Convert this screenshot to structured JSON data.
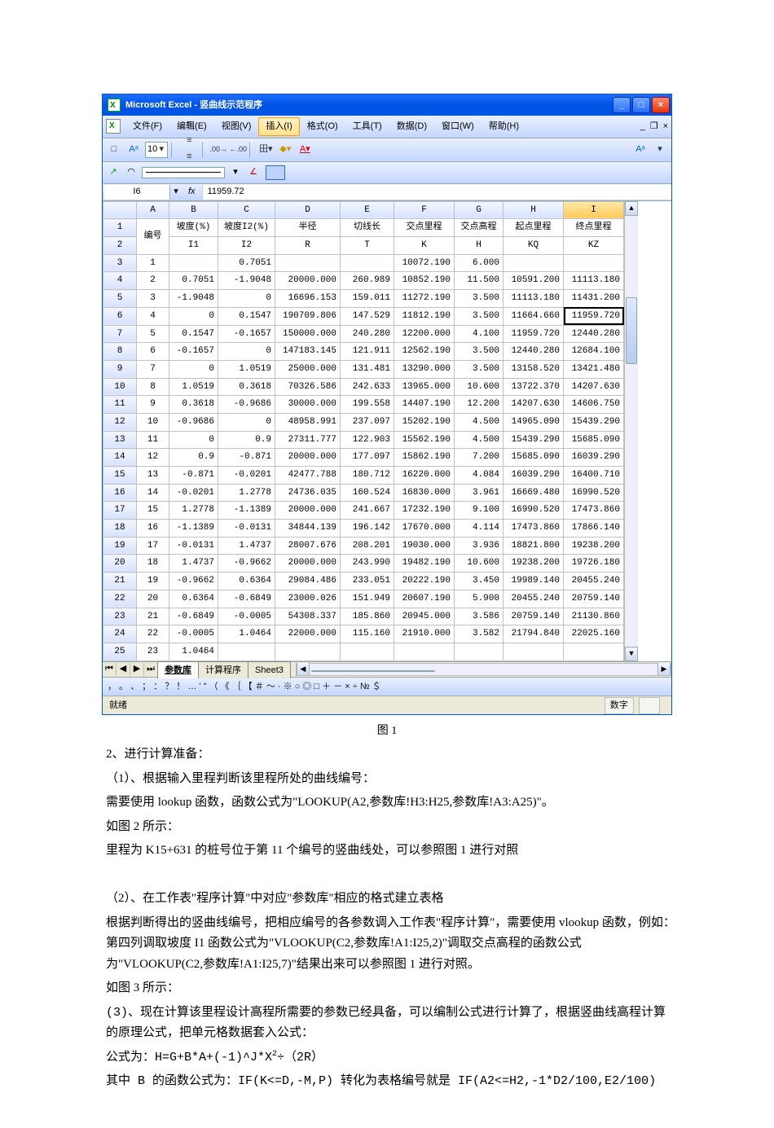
{
  "window": {
    "title": "Microsoft Excel - 竖曲线示范程序"
  },
  "menu": {
    "file": "文件(F)",
    "edit": "编辑(E)",
    "view": "视图(V)",
    "insert": "插入(I)",
    "format": "格式(O)",
    "tools": "工具(T)",
    "data": "数据(D)",
    "window": "窗口(W)",
    "help": "帮助(H)"
  },
  "toolbar": {
    "fontsize": "10"
  },
  "namebox": "I6",
  "formula": "11959.72",
  "columns": [
    "A",
    "B",
    "C",
    "D",
    "E",
    "F",
    "G",
    "H",
    "I"
  ],
  "header1": [
    "编号",
    "坡度(%)",
    "坡度I2(%)",
    "半径",
    "切线长",
    "交点里程",
    "交点高程",
    "起点里程",
    "终点里程"
  ],
  "header2": [
    "",
    "I1",
    "I2",
    "R",
    "T",
    "K",
    "H",
    "KQ",
    "KZ"
  ],
  "rows": [
    {
      "n": "1",
      "I1": "",
      "I2": "0.7051",
      "R": "",
      "T": "",
      "K": "10072.190",
      "H": "6.000",
      "KQ": "",
      "KZ": ""
    },
    {
      "n": "2",
      "I1": "0.7051",
      "I2": "-1.9048",
      "R": "20000.000",
      "T": "260.989",
      "K": "10852.190",
      "H": "11.500",
      "KQ": "10591.200",
      "KZ": "11113.180"
    },
    {
      "n": "3",
      "I1": "-1.9048",
      "I2": "0",
      "R": "16696.153",
      "T": "159.011",
      "K": "11272.190",
      "H": "3.500",
      "KQ": "11113.180",
      "KZ": "11431.200"
    },
    {
      "n": "4",
      "I1": "0",
      "I2": "0.1547",
      "R": "190709.806",
      "T": "147.529",
      "K": "11812.190",
      "H": "3.500",
      "KQ": "11664.660",
      "KZ": "11959.720"
    },
    {
      "n": "5",
      "I1": "0.1547",
      "I2": "-0.1657",
      "R": "150000.000",
      "T": "240.280",
      "K": "12200.000",
      "H": "4.100",
      "KQ": "11959.720",
      "KZ": "12440.280"
    },
    {
      "n": "6",
      "I1": "-0.1657",
      "I2": "0",
      "R": "147183.145",
      "T": "121.911",
      "K": "12562.190",
      "H": "3.500",
      "KQ": "12440.280",
      "KZ": "12684.100"
    },
    {
      "n": "7",
      "I1": "0",
      "I2": "1.0519",
      "R": "25000.000",
      "T": "131.481",
      "K": "13290.000",
      "H": "3.500",
      "KQ": "13158.520",
      "KZ": "13421.480"
    },
    {
      "n": "8",
      "I1": "1.0519",
      "I2": "0.3618",
      "R": "70326.586",
      "T": "242.633",
      "K": "13965.000",
      "H": "10.600",
      "KQ": "13722.370",
      "KZ": "14207.630"
    },
    {
      "n": "9",
      "I1": "0.3618",
      "I2": "-0.9686",
      "R": "30000.000",
      "T": "199.558",
      "K": "14407.190",
      "H": "12.200",
      "KQ": "14207.630",
      "KZ": "14606.750"
    },
    {
      "n": "10",
      "I1": "-0.9686",
      "I2": "0",
      "R": "48958.991",
      "T": "237.097",
      "K": "15202.190",
      "H": "4.500",
      "KQ": "14965.090",
      "KZ": "15439.290"
    },
    {
      "n": "11",
      "I1": "0",
      "I2": "0.9",
      "R": "27311.777",
      "T": "122.903",
      "K": "15562.190",
      "H": "4.500",
      "KQ": "15439.290",
      "KZ": "15685.090"
    },
    {
      "n": "12",
      "I1": "0.9",
      "I2": "-0.871",
      "R": "20000.000",
      "T": "177.097",
      "K": "15862.190",
      "H": "7.200",
      "KQ": "15685.090",
      "KZ": "16039.290"
    },
    {
      "n": "13",
      "I1": "-0.871",
      "I2": "-0.0201",
      "R": "42477.788",
      "T": "180.712",
      "K": "16220.000",
      "H": "4.084",
      "KQ": "16039.290",
      "KZ": "16400.710"
    },
    {
      "n": "14",
      "I1": "-0.0201",
      "I2": "1.2778",
      "R": "24736.035",
      "T": "160.524",
      "K": "16830.000",
      "H": "3.961",
      "KQ": "16669.480",
      "KZ": "16990.520"
    },
    {
      "n": "15",
      "I1": "1.2778",
      "I2": "-1.1389",
      "R": "20000.000",
      "T": "241.667",
      "K": "17232.190",
      "H": "9.100",
      "KQ": "16990.520",
      "KZ": "17473.860"
    },
    {
      "n": "16",
      "I1": "-1.1389",
      "I2": "-0.0131",
      "R": "34844.139",
      "T": "196.142",
      "K": "17670.000",
      "H": "4.114",
      "KQ": "17473.860",
      "KZ": "17866.140"
    },
    {
      "n": "17",
      "I1": "-0.0131",
      "I2": "1.4737",
      "R": "28007.676",
      "T": "208.201",
      "K": "19030.000",
      "H": "3.936",
      "KQ": "18821.800",
      "KZ": "19238.200"
    },
    {
      "n": "18",
      "I1": "1.4737",
      "I2": "-0.9662",
      "R": "20000.000",
      "T": "243.990",
      "K": "19482.190",
      "H": "10.600",
      "KQ": "19238.200",
      "KZ": "19726.180"
    },
    {
      "n": "19",
      "I1": "-0.9662",
      "I2": "0.6364",
      "R": "29084.486",
      "T": "233.051",
      "K": "20222.190",
      "H": "3.450",
      "KQ": "19989.140",
      "KZ": "20455.240"
    },
    {
      "n": "20",
      "I1": "0.6364",
      "I2": "-0.6849",
      "R": "23000.026",
      "T": "151.949",
      "K": "20607.190",
      "H": "5.900",
      "KQ": "20455.240",
      "KZ": "20759.140"
    },
    {
      "n": "21",
      "I1": "-0.6849",
      "I2": "-0.0005",
      "R": "54308.337",
      "T": "185.860",
      "K": "20945.000",
      "H": "3.586",
      "KQ": "20759.140",
      "KZ": "21130.860"
    },
    {
      "n": "22",
      "I1": "-0.0005",
      "I2": "1.0464",
      "R": "22000.000",
      "T": "115.160",
      "K": "21910.000",
      "H": "3.582",
      "KQ": "21794.840",
      "KZ": "22025.160"
    },
    {
      "n": "23",
      "I1": "1.0464",
      "I2": "",
      "R": "",
      "T": "",
      "K": "",
      "H": "",
      "KQ": "",
      "KZ": ""
    }
  ],
  "tabs": [
    "参数库",
    "计算程序",
    "Sheet3"
  ],
  "status": {
    "ready": "就绪",
    "num": "数字"
  },
  "symbols": "，  。  、  ；  ：  ？  ！  …  '  \"  （  《  ｛  【  ＃  ～  ·  ※  ○  ◎  □  ＋  －  ×  ÷  №  ＄",
  "caption": "图 1",
  "doc": {
    "s0": "2、进行计算准备：",
    "s1": "（1）、根据输入里程判断该里程所处的曲线编号：",
    "s2a": "需要使用 lookup 函数，函数公式为\"",
    "s2b": "LOOKUP(A2,参数库!H3:H25,参数库!A3:A25)",
    "s2c": "\"。",
    "s3": "如图 2 所示：",
    "s4": "里程为 K15+631 的桩号位于第 11 个编号的竖曲线处，可以参照图 1 进行对照",
    "s5": "（2）、在工作表\"程序计算\"中对应\"参数库\"相应的格式建立表格",
    "s6": "根据判断得出的竖曲线编号，把相应编号的各参数调入工作表\"程序计算\"，需要使用 vlookup 函数，例如：第四列调取坡度 I1 函数公式为\"VLOOKUP(C2,参数库!A1:I25,2)\"调取交点高程的函数公式为\"VLOOKUP(C2,参数库!A1:I25,7)\"结果出来可以参照图 1 进行对照。",
    "s7": "如图 3 所示：",
    "s8": "(3)、现在计算该里程设计高程所需要的参数已经具备，可以编制公式进行计算了，根据竖曲线高程计算的原理公式，把单元格数据套入公式：",
    "s9a": "公式为：H=G+B*A+(-1)^J*X",
    "s9b": "÷（2R）",
    "s10": "其中 B 的函数公式为：IF(K<=D,-M,P) 转化为表格编号就是 IF(A2<=H2,-1*D2/100,E2/100)"
  }
}
